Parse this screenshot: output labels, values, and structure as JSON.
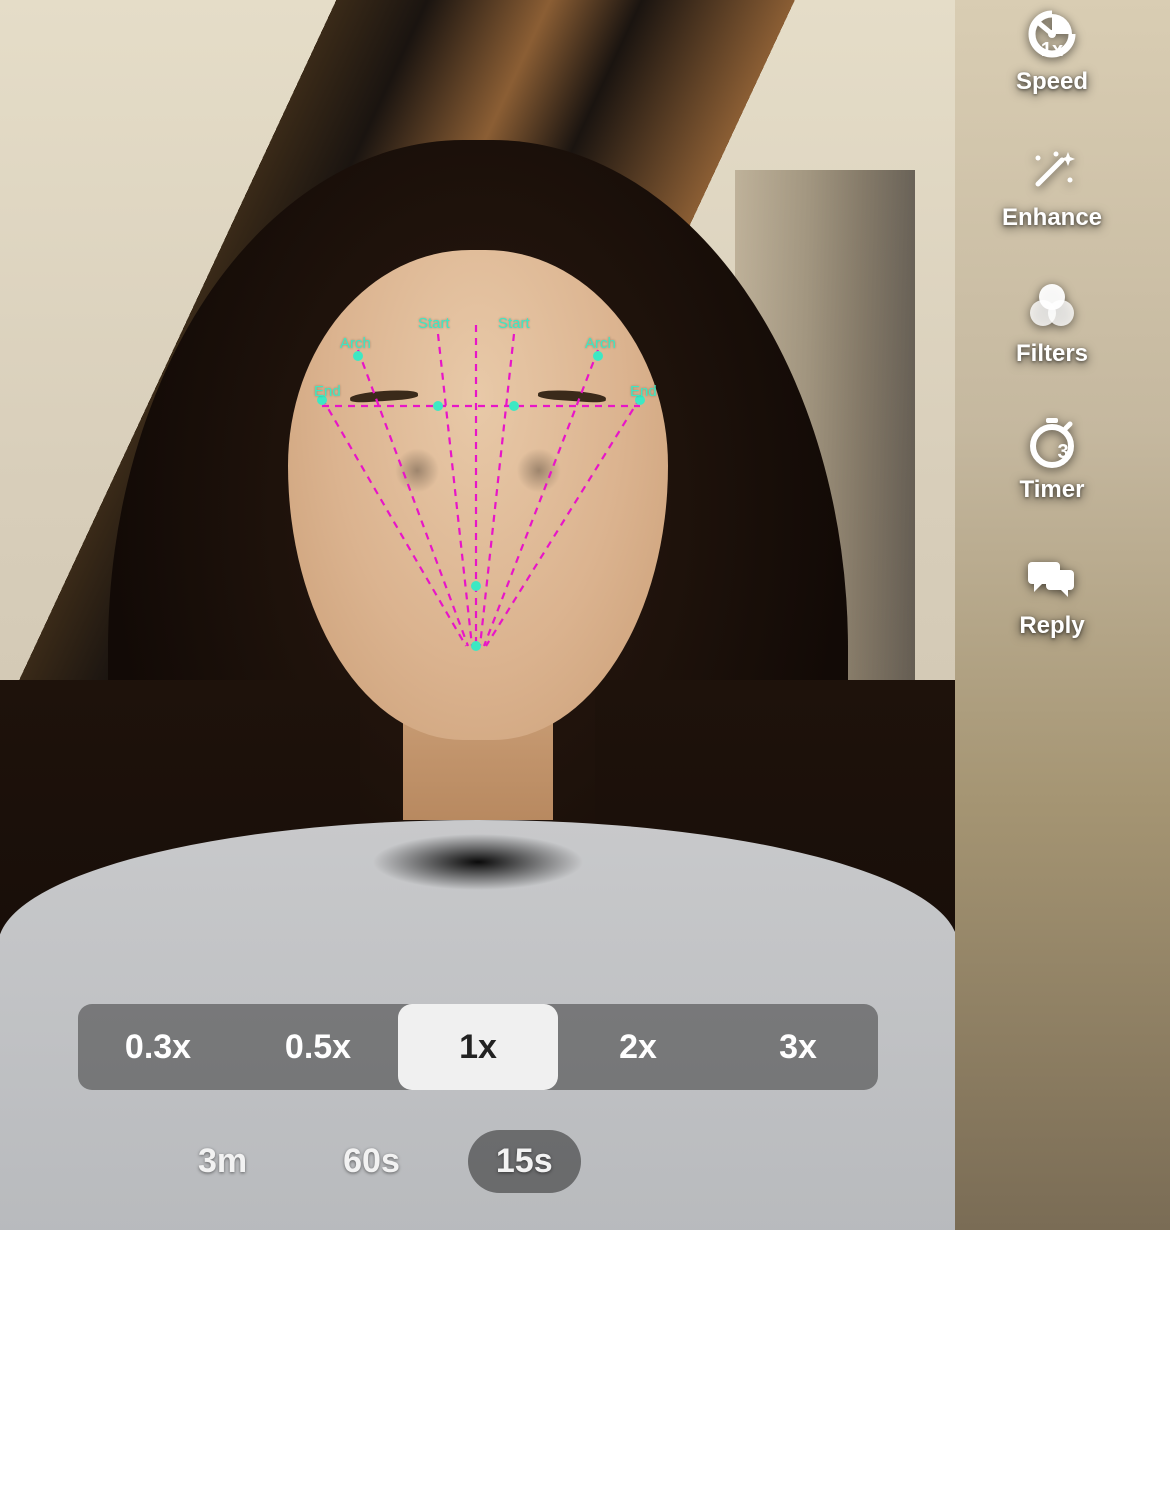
{
  "toolbar": {
    "speed": {
      "label": "Speed",
      "badge": "1x"
    },
    "enhance": {
      "label": "Enhance"
    },
    "filters": {
      "label": "Filters"
    },
    "timer": {
      "label": "Timer",
      "badge": "3"
    },
    "reply": {
      "label": "Reply"
    }
  },
  "speed_options": [
    "0.3x",
    "0.5x",
    "1x",
    "2x",
    "3x"
  ],
  "speed_selected": "1x",
  "duration_options": [
    "3m",
    "60s",
    "15s"
  ],
  "duration_selected": "15s",
  "ar": {
    "labels": {
      "arch_left": "Arch",
      "start_left": "Start",
      "start_right": "Start",
      "arch_right": "Arch",
      "end_left": "End",
      "end_right": "End"
    }
  }
}
